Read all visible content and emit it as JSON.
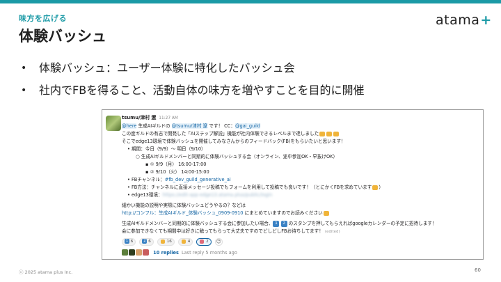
{
  "header": {
    "section_label": "味方を広げる",
    "title": "体験バッシュ",
    "logo_text": "atama",
    "logo_plus": "+",
    "accent_color": "#1b9aa6"
  },
  "bullets": [
    "体験バッシュ：ユーザー体験に特化したバッシュ会",
    "社内でFBを得ること、活動自体の味方を増やすことを目的に開催"
  ],
  "slack": {
    "author": "tsumu/津村 遼",
    "time": "11:27 AM",
    "l1_a": "@here",
    "l1_b": " 生成AIギルドの ",
    "l1_c": "@tsumu/津村 遼",
    "l1_d": " です！ CC：",
    "l1_e": "@gai_guild",
    "l2": "この度ギルドの有志で開発した「AIステップ解説」機能が社内体験できるレベルまで達しました",
    "l3": "そこでedge13環境で体験バッシュを開催してみなさんからのフィードバック(FB)をもらいたいと思います！",
    "l4": "期間：今日（9/9）〜 明日（9/10）",
    "l5": "生成AIギルドメンバーと同期的に体験バッシュする会（オンライン、途中参加OK・早抜けOK）",
    "l6": "① 9/9（月） 16:00-17:00",
    "l7": "② 9/10（火） 14:00-15:00",
    "l8_a": "FBチャンネル：",
    "l8_b": "#fb_dev_guild_generative_ai",
    "l9": "FB方法：チャンネルに直接メッセージ投稿でもフォームを利用して投稿でも良いです！（とにかくFBを求めています",
    "l9_end": "）",
    "l10_a": "edge13環境：",
    "l10_b": "https://edit-app-edge13.atama.plus/public/login",
    "l11": "細かい機能の説明や実際に体験バッシュどうやるの？などは",
    "l12_a": "http://コンフル：生成AIギルド_体験バッシュ_0909-0910",
    "l12_b": " にまとめていますのでお読みください",
    "l13_a": "生成AIギルドメンバーと同期的に体験バッシュする会に参加したい場合、",
    "l13_n1": "1",
    "l13_n2": "2",
    "l13_b": " のスタンプを押してもらえればgoogleカレンダーの予定に招待します！",
    "l14": "会に参加できなくても期間中は好きに触ってもらって大丈夫ですのでどしどしFBお待ちしてます！",
    "l14_edited": "(edited)",
    "reactions": [
      {
        "label": "1",
        "count": "6"
      },
      {
        "label": "2",
        "count": "6"
      },
      {
        "label": "clap",
        "count": "16"
      },
      {
        "label": "party",
        "count": "4"
      },
      {
        "label": "heart",
        "count": "2"
      }
    ],
    "add_reaction": "☺",
    "replies_count": "10 replies",
    "replies_last": "Last reply 5 months ago"
  },
  "footer": {
    "copyright": "ⓒ 2025 atama plus Inc.",
    "page": "60"
  }
}
